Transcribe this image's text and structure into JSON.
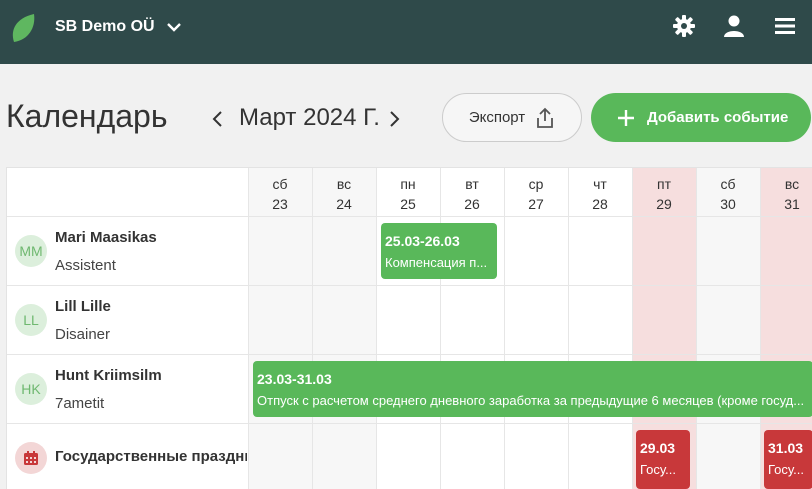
{
  "app": {
    "org_name": "SB Demo OÜ",
    "icons": [
      "leaf-logo-icon",
      "chevron-down-icon",
      "gear-icon",
      "user-icon",
      "menu-icon"
    ],
    "colors": {
      "topbar": "#2f4a4a",
      "accent": "#59b85a",
      "holiday": "#c8383a"
    }
  },
  "calendar": {
    "title": "Календарь",
    "month_label": "Март 2024 Г.",
    "export_label": "Экспорт",
    "add_event_label": "Добавить событие",
    "days": [
      {
        "dow": "сб",
        "date": "23",
        "kind": "weekend"
      },
      {
        "dow": "вс",
        "date": "24",
        "kind": "weekend"
      },
      {
        "dow": "пн",
        "date": "25",
        "kind": "work"
      },
      {
        "dow": "вт",
        "date": "26",
        "kind": "work"
      },
      {
        "dow": "ср",
        "date": "27",
        "kind": "work"
      },
      {
        "dow": "чт",
        "date": "28",
        "kind": "work"
      },
      {
        "dow": "пт",
        "date": "29",
        "kind": "holiday"
      },
      {
        "dow": "сб",
        "date": "30",
        "kind": "weekend"
      },
      {
        "dow": "вс",
        "date": "31",
        "kind": "holiday"
      }
    ],
    "people": [
      {
        "initials": "MM",
        "name": "Mari Maasikas",
        "role": "Assistent"
      },
      {
        "initials": "LL",
        "name": "Lill Lille",
        "role": "Disainer"
      },
      {
        "initials": "HK",
        "name": "Hunt Kriimsilm",
        "role": "7ametit"
      }
    ],
    "holiday_row": {
      "name": "Государственные праздники"
    },
    "events": [
      {
        "date_range": "25.03-26.03",
        "description": "Компенсация п..."
      },
      {
        "date_range": "23.03-31.03",
        "description": "Отпуск с расчетом среднего дневного заработка за предыдущие 6 месяцев (кроме госуд..."
      },
      {
        "date_range": "29.03",
        "description": "Госу..."
      },
      {
        "date_range": "31.03",
        "description": "Госу..."
      }
    ]
  }
}
